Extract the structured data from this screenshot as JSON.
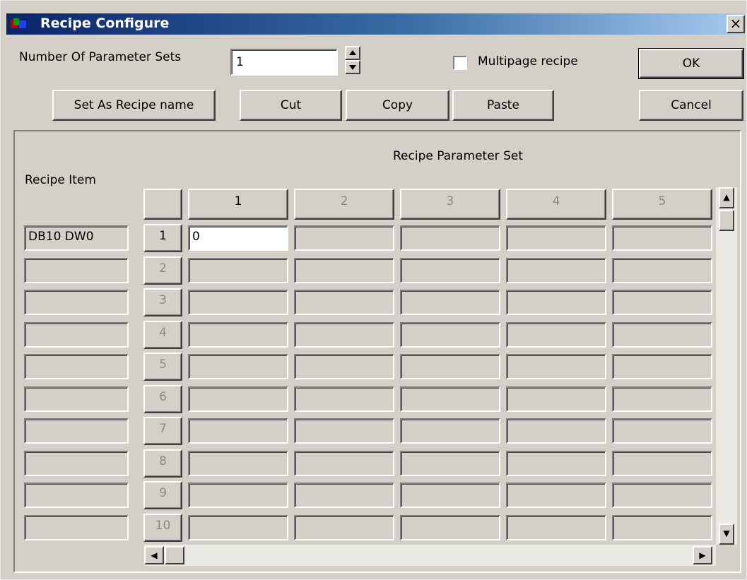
{
  "window": {
    "title": "Recipe Configure",
    "close_symbol": "×"
  },
  "top": {
    "param_sets_label": "Number Of Parameter Sets",
    "param_sets_value": "1",
    "multipage_label": "Multipage recipe",
    "multipage_checked": false
  },
  "buttons": {
    "ok": "OK",
    "cancel": "Cancel",
    "set_as_recipe_name": "Set As Recipe name",
    "cut": "Cut",
    "copy": "Copy",
    "paste": "Paste"
  },
  "grid": {
    "set_title": "Recipe Parameter Set",
    "item_title": "Recipe Item",
    "columns": [
      "1",
      "2",
      "3",
      "4",
      "5"
    ],
    "rows": [
      "1",
      "2",
      "3",
      "4",
      "5",
      "6",
      "7",
      "8",
      "9",
      "10"
    ],
    "items": [
      "DB10 DW0",
      "",
      "",
      "",
      "",
      "",
      "",
      "",
      "",
      ""
    ],
    "values": [
      [
        "0",
        "",
        "",
        "",
        ""
      ],
      [
        "",
        "",
        "",
        "",
        ""
      ],
      [
        "",
        "",
        "",
        "",
        ""
      ],
      [
        "",
        "",
        "",
        "",
        ""
      ],
      [
        "",
        "",
        "",
        "",
        ""
      ],
      [
        "",
        "",
        "",
        "",
        ""
      ],
      [
        "",
        "",
        "",
        "",
        ""
      ],
      [
        "",
        "",
        "",
        "",
        ""
      ],
      [
        "",
        "",
        "",
        "",
        ""
      ],
      [
        "",
        "",
        "",
        "",
        ""
      ]
    ]
  },
  "scroll": {
    "up": "▲",
    "down": "▼",
    "left": "◀",
    "right": "▶"
  }
}
